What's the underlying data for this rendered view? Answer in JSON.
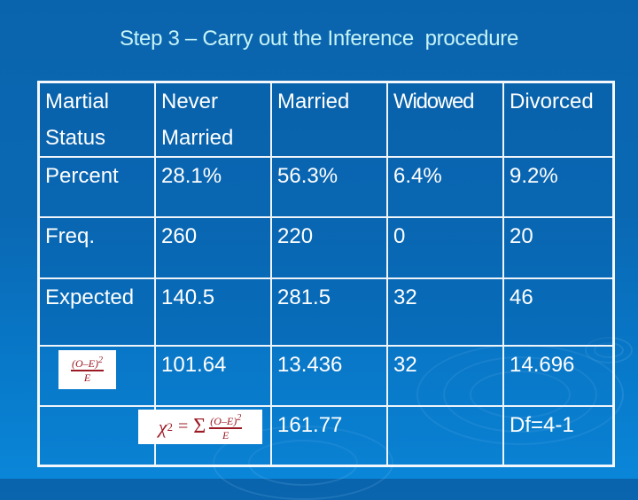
{
  "slide": {
    "title": "Step 3 – Carry out the Inference  procedure",
    "colors": {
      "background": "#0a68b3",
      "title_text": "#c6f3f7",
      "cell_text": "#ffffff",
      "grid_lines": "#eef4fa",
      "formula_text": "#9c1a24"
    }
  },
  "table": {
    "header": {
      "label": "Martial Status",
      "label_line1": "Martial",
      "label_line2": "Status",
      "categories": [
        {
          "line1": "Never",
          "line2": "Married"
        },
        {
          "line1": "Married",
          "line2": ""
        },
        {
          "line1": "Widowed",
          "line2": ""
        },
        {
          "line1": "Divorced",
          "line2": ""
        }
      ]
    },
    "rows": [
      {
        "label": "Percent",
        "values": [
          "28.1%",
          "56.3%",
          "6.4%",
          "9.2%"
        ]
      },
      {
        "label": "Freq.",
        "values": [
          "260",
          "220",
          "0",
          "20"
        ]
      },
      {
        "label": "Expected",
        "values": [
          "140.5",
          "281.5",
          "32",
          "46"
        ]
      },
      {
        "label_formula": "(O-E)^2 / E",
        "values": [
          "101.64",
          "13.436",
          "32",
          "14.696"
        ]
      }
    ],
    "summary": {
      "formula": "χ^2 = Σ (O-E)^2 / E",
      "chi_square_value": "161.77",
      "df": "Df=4-1"
    }
  },
  "formulas": {
    "cell": {
      "numerator": "(O–E)",
      "exponent": "2",
      "denominator": "E"
    },
    "chi": {
      "symbol": "χ",
      "exponent": "2",
      "equals": "=",
      "sigma": "Σ",
      "numerator": "(O–E)",
      "num_exponent": "2",
      "denominator": "E"
    }
  }
}
